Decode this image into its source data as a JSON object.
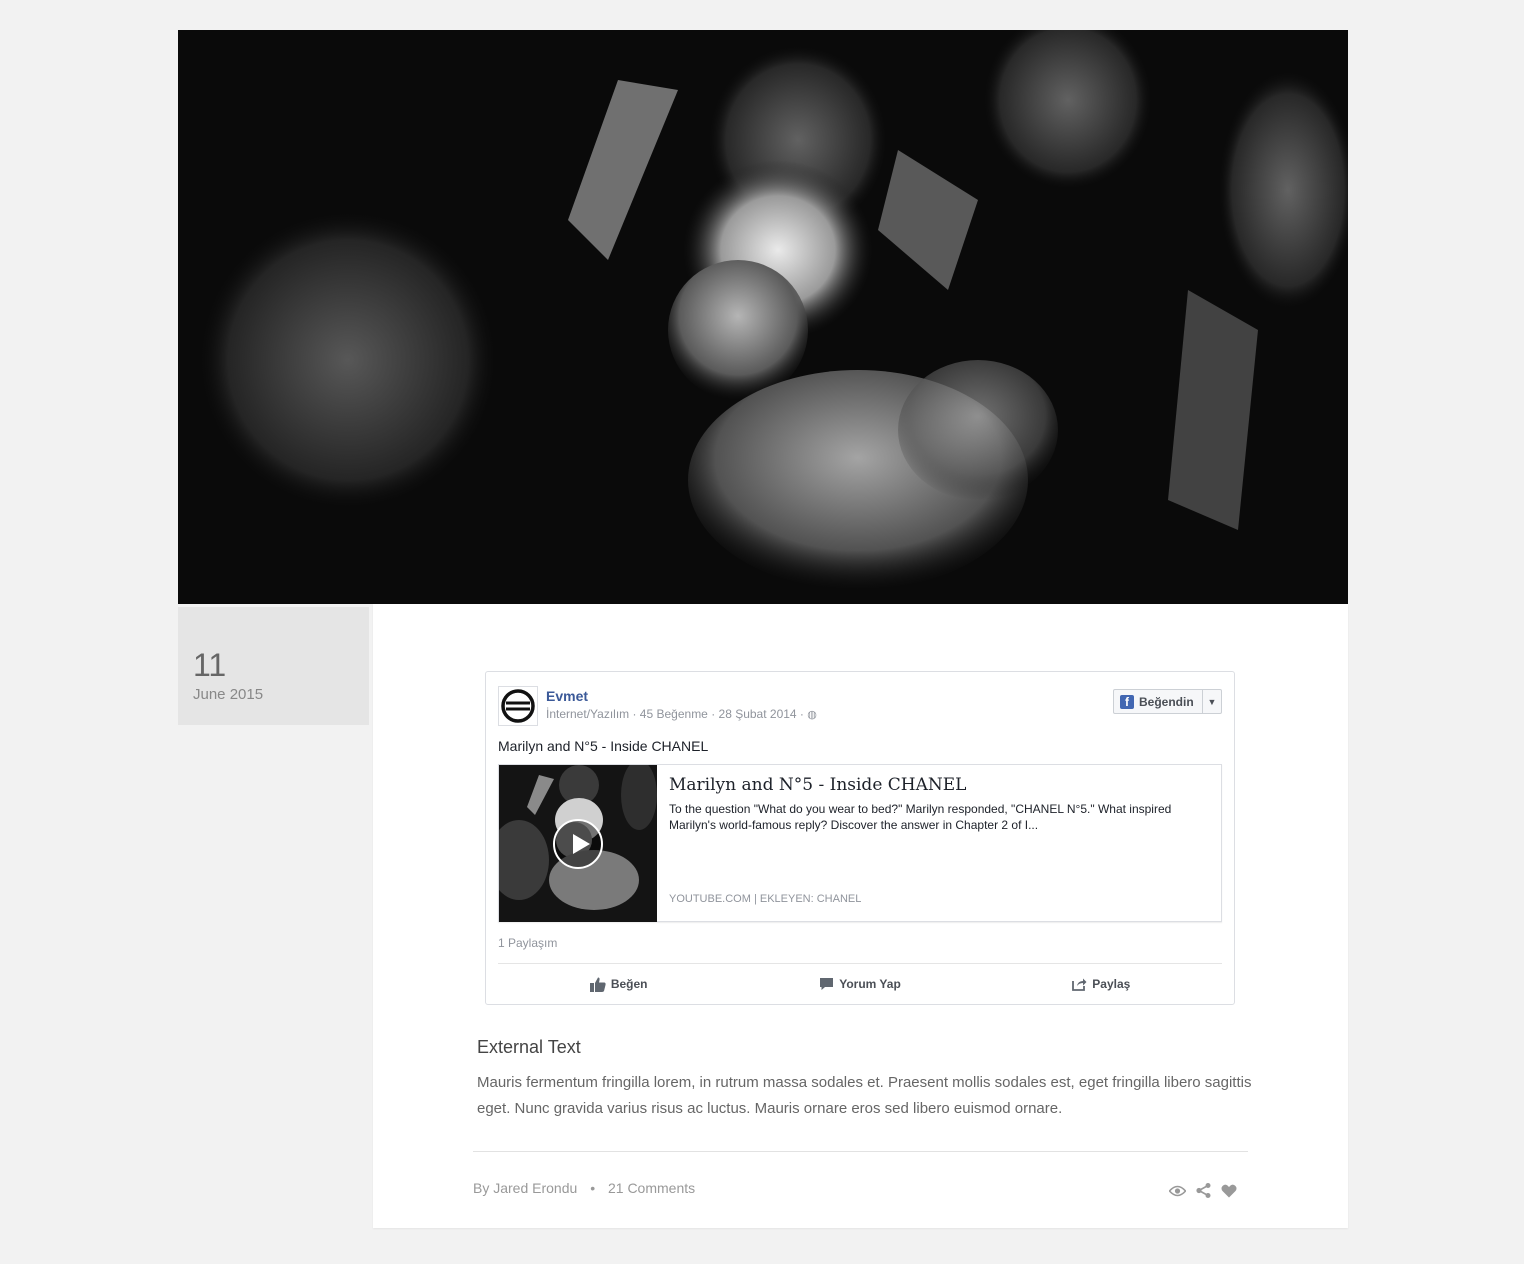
{
  "date": {
    "day": "11",
    "month": "June 2015"
  },
  "facebook": {
    "page_name": "Evmet",
    "page_meta": "İnternet/Yazılım · 45 Beğenme · 28 Şubat 2014 ·",
    "like_button": "Beğendin",
    "post_text": "Marilyn and N°5 - Inside CHANEL",
    "card": {
      "title": "Marilyn and N°5 - Inside CHANEL",
      "description": "To the question \"What do you wear to bed?\" Marilyn responded, \"CHANEL N°5.\" What inspired Marilyn's world-famous reply? Discover the answer in Chapter 2 of I...",
      "source": "YOUTUBE.COM | EKLEYEN: CHANEL"
    },
    "shares": "1 Paylaşım",
    "actions": {
      "like": "Beğen",
      "comment": "Yorum Yap",
      "share": "Paylaş"
    }
  },
  "external": {
    "title": "External Text",
    "body": "Mauris fermentum fringilla lorem, in rutrum massa sodales et. Praesent mollis sodales est, eget fringilla libero sagittis eget. Nunc gravida varius risus ac luctus. Mauris ornare eros sed libero euismod ornare."
  },
  "footer": {
    "author": "By Jared Erondu",
    "separator": "•",
    "comments": "21 Comments",
    "icons": [
      "eye-icon",
      "share-icon",
      "heart-icon"
    ]
  },
  "colors": {
    "fb_blue": "#3b5998",
    "hero_bg": "#0a0a0a",
    "page_bg": "#f2f2f2"
  }
}
